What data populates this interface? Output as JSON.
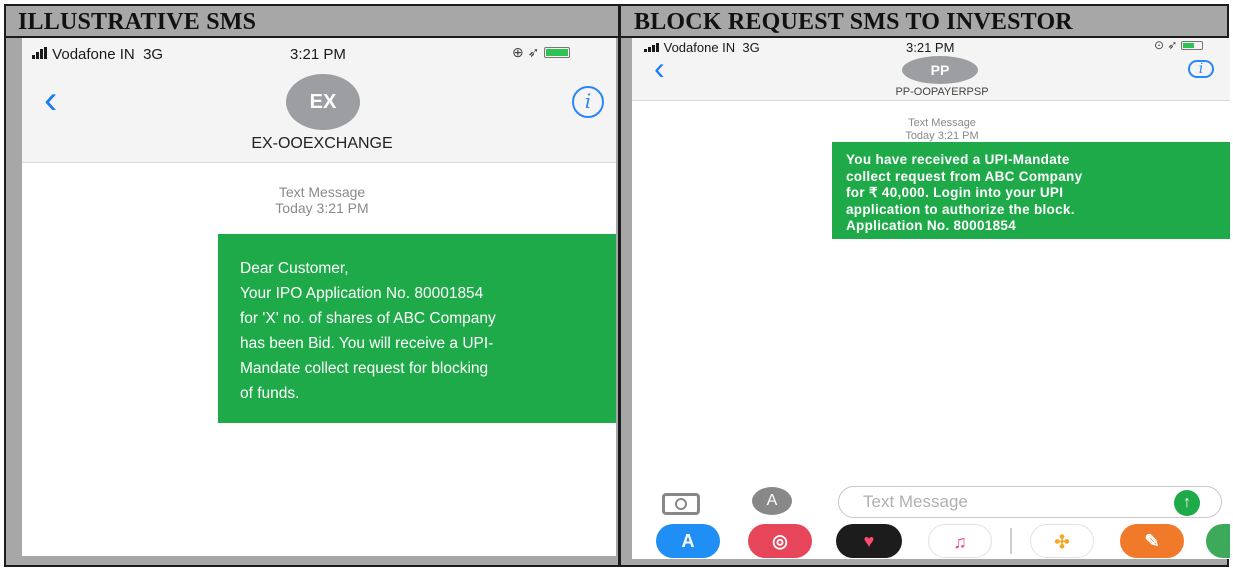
{
  "headers": {
    "left": "ILLUSTRATIVE SMS",
    "right": "BLOCK REQUEST SMS TO INVESTOR"
  },
  "left_phone": {
    "status": {
      "carrier": "Vodafone IN",
      "network": "3G",
      "time": "3:21 PM"
    },
    "avatar_initials": "EX",
    "contact_name": "EX-OOEXCHANGE",
    "meta": {
      "label": "Text Message",
      "time": "Today 3:21 PM"
    },
    "message_lines": [
      "Dear Customer,",
      "Your IPO Application No. 80001854",
      "for 'X' no. of shares of ABC Company",
      "has been Bid. You will receive a UPI-",
      "Mandate collect request for blocking",
      "of funds."
    ]
  },
  "right_phone": {
    "status": {
      "carrier": "Vodafone IN",
      "network": "3G",
      "time": "3:21 PM"
    },
    "avatar_initials": "PP",
    "contact_name": "PP-OOPAYERPSP",
    "meta": {
      "label": "Text Message",
      "time": "Today 3:21 PM"
    },
    "message_lines": [
      "You have received a UPI-Mandate",
      "collect request from ABC Company",
      "for ₹ 40,000. Login into your UPI",
      "application to authorize the block.",
      "Application No. 80001854"
    ],
    "composer": {
      "placeholder": "Text Message"
    }
  },
  "colors": {
    "bubble": "#1faa4a",
    "ios_blue": "#1a7cf5",
    "avatar": "#9c9ea2",
    "table_border": "#1c1c1c",
    "table_fill": "#a7a7a7"
  },
  "icons": {
    "back": "chevron-left-icon",
    "info": "info-icon",
    "camera": "camera-icon",
    "apps": "app-store-icon",
    "send": "send-arrow-icon"
  }
}
